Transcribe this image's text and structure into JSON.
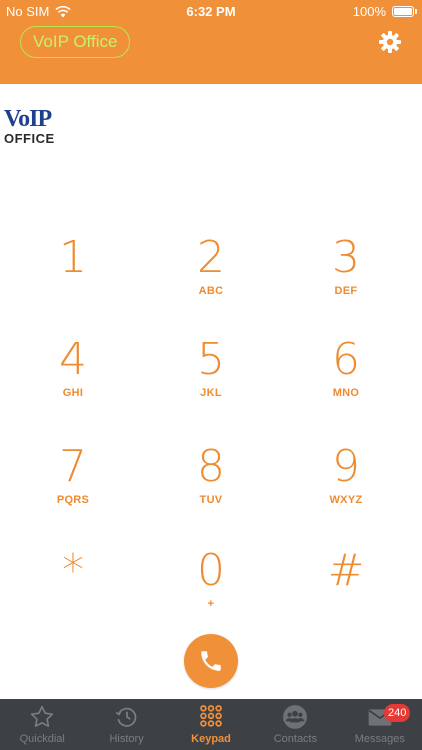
{
  "status_bar": {
    "carrier": "No SIM",
    "time": "6:32 PM",
    "battery": "100%"
  },
  "header": {
    "brand": "VoIP Office",
    "settings_icon": "gear-icon"
  },
  "logo": {
    "line1": "VoIP",
    "line2": "OFFICE"
  },
  "keypad": {
    "keys": [
      {
        "digit": "1",
        "letters": ""
      },
      {
        "digit": "2",
        "letters": "ABC"
      },
      {
        "digit": "3",
        "letters": "DEF"
      },
      {
        "digit": "4",
        "letters": "GHI"
      },
      {
        "digit": "5",
        "letters": "JKL"
      },
      {
        "digit": "6",
        "letters": "MNO"
      },
      {
        "digit": "7",
        "letters": "PQRS"
      },
      {
        "digit": "8",
        "letters": "TUV"
      },
      {
        "digit": "9",
        "letters": "WXYZ"
      },
      {
        "digit": "*",
        "letters": ""
      },
      {
        "digit": "0",
        "letters": "+"
      },
      {
        "digit": "#",
        "letters": ""
      }
    ]
  },
  "call": {
    "icon": "phone-icon"
  },
  "tabs": [
    {
      "label": "Quickdial",
      "icon": "star-icon",
      "active": false
    },
    {
      "label": "History",
      "icon": "clock-history-icon",
      "active": false
    },
    {
      "label": "Keypad",
      "icon": "keypad-grid-icon",
      "active": true
    },
    {
      "label": "Contacts",
      "icon": "contacts-icon",
      "active": false
    },
    {
      "label": "Messages",
      "icon": "envelope-icon",
      "active": false
    }
  ],
  "messages_badge": "240",
  "colors": {
    "accent": "#f0913a",
    "tabbar": "#3d4146",
    "badge": "#e53935",
    "brand_pill": "#b7e64a"
  }
}
